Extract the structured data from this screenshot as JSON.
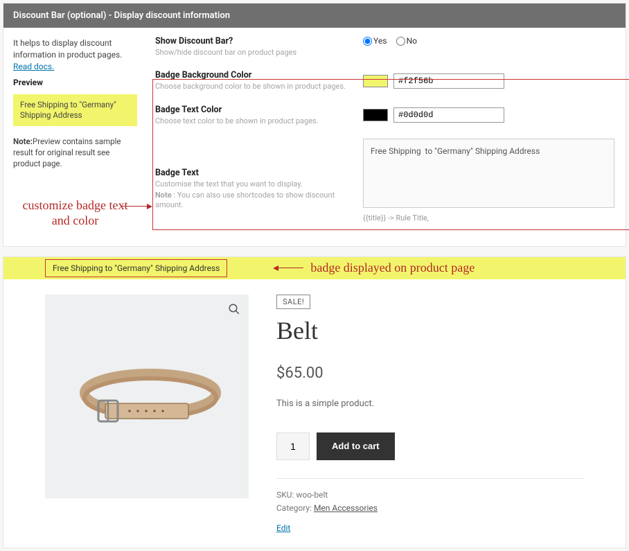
{
  "panel": {
    "title": "Discount Bar (optional) - Display discount information"
  },
  "sidebar": {
    "helpText": "It helps to display discount information in product pages. ",
    "docsLink": "Read docs.",
    "previewLabel": "Preview",
    "badgePreview": "Free Shipping to \"Germany\" Shipping Address",
    "noteLabel": "Note:",
    "noteText": "Preview contains sample result for original result see product page."
  },
  "annotation1": "customize badge text and color",
  "form": {
    "showBar": {
      "label": "Show Discount Bar?",
      "help": "Show/hide discount bar on product pages",
      "yes": "Yes",
      "no": "No"
    },
    "bgColor": {
      "label": "Badge Background Color",
      "help": "Choose background color to be shown in product pages.",
      "value": "#f2f56b",
      "swatch": "#f2f56b"
    },
    "textColor": {
      "label": "Badge Text Color",
      "help": "Choose text color to be shown in product pages.",
      "value": "#0d0d0d",
      "swatch": "#000000"
    },
    "badgeText": {
      "label": "Badge Text",
      "help1": "Customise the text that you want to display.",
      "help2Label": "Note",
      "help2": " : You can also use shortcodes to show discount amount.",
      "value": "Free Shipping  to \"Germany\" Shipping Address",
      "hint": "{{title}} -> Rule Title,"
    }
  },
  "annotation2": "badge displayed on product page",
  "product": {
    "badge": "Free Shipping to \"Germany\" Shipping Address",
    "sale": "SALE!",
    "title": "Belt",
    "price": "$65.00",
    "desc": "This is a simple product.",
    "qty": "1",
    "addToCart": "Add to cart",
    "skuLabel": "SKU: ",
    "sku": "woo-belt",
    "catLabel": "Category: ",
    "category": "Men Accessories",
    "edit": "Edit"
  }
}
